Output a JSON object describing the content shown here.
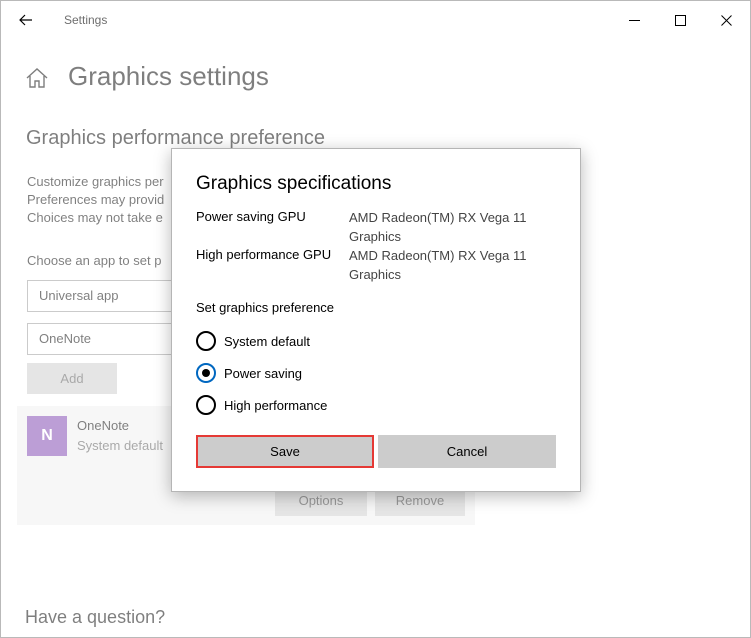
{
  "window": {
    "title": "Settings",
    "icons": {
      "back": "arrow-left-icon",
      "minimize": "minimize-icon",
      "maximize": "maximize-icon",
      "close": "close-icon"
    }
  },
  "page": {
    "title": "Graphics settings",
    "section_title": "Graphics performance preference",
    "description_lines": [
      "Customize graphics per",
      "Preferences may provid",
      "Choices may not take e"
    ],
    "choose_label": "Choose an app to set p",
    "app_type_select": "Universal app",
    "app_select": "OneNote",
    "add_button": "Add",
    "app_item": {
      "name": "OneNote",
      "status": "System default",
      "icon_letter": "N",
      "options_button": "Options",
      "remove_button": "Remove"
    },
    "question": "Have a question?"
  },
  "dialog": {
    "title": "Graphics specifications",
    "specs": [
      {
        "label": "Power saving GPU",
        "value_line1": "AMD Radeon(TM) RX Vega 11",
        "value_line2": "Graphics"
      },
      {
        "label": "High performance GPU",
        "value_line1": "AMD Radeon(TM) RX Vega 11",
        "value_line2": "Graphics"
      }
    ],
    "preference_label": "Set graphics preference",
    "options": [
      {
        "label": "System default",
        "selected": false
      },
      {
        "label": "Power saving",
        "selected": true
      },
      {
        "label": "High performance",
        "selected": false
      }
    ],
    "save_button": "Save",
    "cancel_button": "Cancel"
  },
  "colors": {
    "accent": "#0067c0",
    "highlight_border": "#e53935",
    "button_gray": "#cccccc",
    "app_icon": "#7b3fae"
  }
}
